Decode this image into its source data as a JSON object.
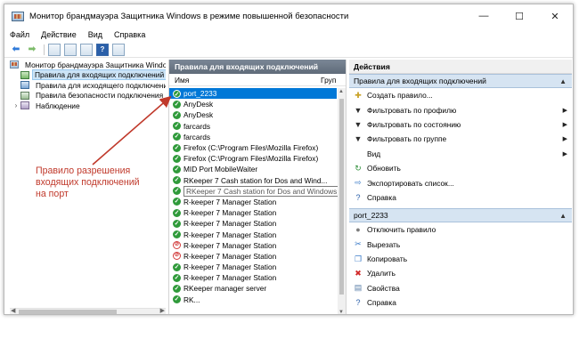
{
  "window": {
    "title": "Монитор брандмауэра Защитника Windows в режиме повышенной безопасности",
    "controls": {
      "minimize": "—",
      "maximize": "☐",
      "close": "✕"
    }
  },
  "menu": [
    "Файл",
    "Действие",
    "Вид",
    "Справка"
  ],
  "toolbar": {
    "help_label": "?"
  },
  "tree": {
    "root": "Монитор брандмауэра Защитника Windows",
    "items": [
      "Правила для входящих подключений",
      "Правила для исходящего подключения",
      "Правила безопасности подключения",
      "Наблюдение"
    ]
  },
  "middle": {
    "header": "Правила для входящих подключений",
    "col_name": "Имя",
    "col_group": "Груп",
    "rules": [
      {
        "name": "port_2233",
        "state": "allow"
      },
      {
        "name": "AnyDesk",
        "state": "allow"
      },
      {
        "name": "AnyDesk",
        "state": "allow"
      },
      {
        "name": "farcards",
        "state": "allow"
      },
      {
        "name": "farcards",
        "state": "allow"
      },
      {
        "name": "Firefox (C:\\Program Files\\Mozilla Firefox)",
        "state": "allow"
      },
      {
        "name": "Firefox (C:\\Program Files\\Mozilla Firefox)",
        "state": "allow"
      },
      {
        "name": "MID Port MobileWaiter",
        "state": "allow"
      },
      {
        "name": "RKeeper 7 Cash station for Dos and Wind...",
        "state": "allow"
      },
      {
        "name": "RKeeper 7 Cash station for Dos and Windows",
        "state": "tooltip"
      },
      {
        "name": "R-keeper 7 Manager Station",
        "state": "allow"
      },
      {
        "name": "R-keeper 7 Manager Station",
        "state": "allow"
      },
      {
        "name": "R-keeper 7 Manager Station",
        "state": "allow"
      },
      {
        "name": "R-keeper 7 Manager Station",
        "state": "allow"
      },
      {
        "name": "R-keeper 7 Manager Station",
        "state": "block"
      },
      {
        "name": "R-keeper 7 Manager Station",
        "state": "block"
      },
      {
        "name": "R-keeper 7 Manager Station",
        "state": "allow"
      },
      {
        "name": "R-keeper 7 Manager Station",
        "state": "allow"
      },
      {
        "name": "RKeeper manager server",
        "state": "allow"
      },
      {
        "name": "RK...",
        "state": "allow"
      }
    ]
  },
  "actions": {
    "header": "Действия",
    "section1": "Правила для входящих подключений",
    "items1": [
      {
        "label": "Создать правило...",
        "icon": "new-rule-icon",
        "glyph": "✚",
        "color": "#c9a227",
        "more": false
      },
      {
        "label": "Фильтровать по профилю",
        "icon": "filter-icon",
        "glyph": "▼",
        "color": "#2d2d2d",
        "more": true
      },
      {
        "label": "Фильтровать по состоянию",
        "icon": "filter-icon",
        "glyph": "▼",
        "color": "#2d2d2d",
        "more": true
      },
      {
        "label": "Фильтровать по группе",
        "icon": "filter-icon",
        "glyph": "▼",
        "color": "#2d2d2d",
        "more": true
      },
      {
        "label": "Вид",
        "icon": "view-icon",
        "glyph": "",
        "color": "#2d2d2d",
        "more": true
      },
      {
        "label": "Обновить",
        "icon": "refresh-icon",
        "glyph": "↻",
        "color": "#2f8f3a",
        "more": false
      },
      {
        "label": "Экспортировать список...",
        "icon": "export-icon",
        "glyph": "⇨",
        "color": "#3b7bc8",
        "more": false
      },
      {
        "label": "Справка",
        "icon": "help-icon",
        "glyph": "?",
        "color": "#2a5fa9",
        "more": false
      }
    ],
    "section2": "port_2233",
    "items2": [
      {
        "label": "Отключить правило",
        "icon": "disable-icon",
        "glyph": "●",
        "color": "#7d7d7d"
      },
      {
        "label": "Вырезать",
        "icon": "cut-icon",
        "glyph": "✂",
        "color": "#3b7bc8"
      },
      {
        "label": "Копировать",
        "icon": "copy-icon",
        "glyph": "❐",
        "color": "#3b7bc8"
      },
      {
        "label": "Удалить",
        "icon": "delete-icon",
        "glyph": "✖",
        "color": "#d12a2a"
      },
      {
        "label": "Свойства",
        "icon": "properties-icon",
        "glyph": "▤",
        "color": "#5a7fa8"
      },
      {
        "label": "Справка",
        "icon": "help-icon",
        "glyph": "?",
        "color": "#2a5fa9"
      }
    ]
  },
  "annotation": {
    "text": "Правило разрешения входящих подключений на порт",
    "color": "#c0392b"
  }
}
